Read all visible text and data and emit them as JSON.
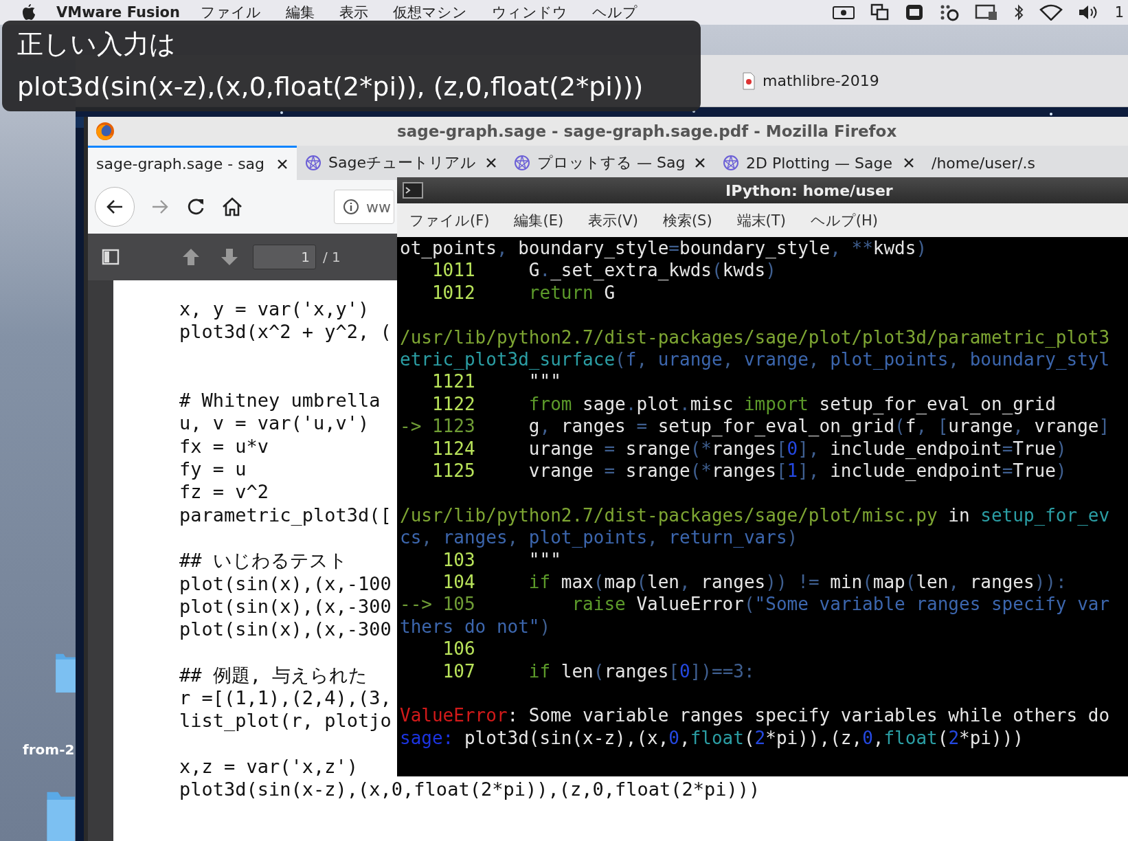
{
  "menu_bar": {
    "app_name": "VMware Fusion",
    "items": [
      "ファイル",
      "編集",
      "表示",
      "仮想マシン",
      "ウィンドウ",
      "ヘルプ"
    ],
    "clock": "1"
  },
  "caption": {
    "lines": [
      "正しい入力は",
      "plot3d(sin(x-z),(x,0,float(2*pi)), (z,0,float(2*pi)))"
    ]
  },
  "vm_window": {
    "tab": "mathlibre-2019"
  },
  "desktop": {
    "icons": [
      {
        "label": "from-2"
      }
    ]
  },
  "browser": {
    "title": "sage-graph.sage - sage-graph.sage.pdf - Mozilla Firefox",
    "tabs": [
      {
        "label": "sage-graph.sage - sag",
        "selected": true,
        "kind": "doc"
      },
      {
        "label": "Sageチュートリアル",
        "selected": false,
        "kind": "sage"
      },
      {
        "label": "プロットする — Sag",
        "selected": false,
        "kind": "sage"
      },
      {
        "label": "2D Plotting — Sage",
        "selected": false,
        "kind": "sage"
      },
      {
        "label": "/home/user/.s",
        "selected": false,
        "kind": "doc"
      }
    ],
    "url": "ww",
    "pdf_toolbar": {
      "page": "1",
      "page_count": "/ 1"
    },
    "pdf_blocks": [
      [
        "x, y = var('x,y')",
        "plot3d(x^2 + y^2, ("
      ],
      [
        "# Whitney umbrella",
        "u, v = var('u,v')",
        "fx = u*v",
        "fy = u",
        "fz = v^2",
        "parametric_plot3d(["
      ],
      [
        "## いじわるテスト",
        "plot(sin(x),(x,-100",
        "plot(sin(x),(x,-300",
        "plot(sin(x),(x,-300"
      ],
      [
        "## 例題, 与えられた",
        "r =[(1,1),(2,4),(3,",
        "list_plot(r, plotjo"
      ],
      [
        "x,z = var('x,z')",
        "plot3d(sin(x-z),(x,0,float(2*pi)),(z,0,float(2*pi)))"
      ]
    ]
  },
  "terminal": {
    "title": "IPython: home/user",
    "menu": [
      "ファイル(F)",
      "編集(E)",
      "表示(V)",
      "検索(S)",
      "端末(T)",
      "ヘルプ(H)"
    ],
    "blocks": [
      [
        [
          {
            "kind": "plain",
            "text": "ot_points"
          },
          {
            "kind": "punct",
            "text": ", "
          },
          {
            "kind": "plain",
            "text": "boundary_style"
          },
          {
            "kind": "punct",
            "text": "="
          },
          {
            "kind": "plain",
            "text": "boundary_style"
          },
          {
            "kind": "punct",
            "text": ", **"
          },
          {
            "kind": "plain",
            "text": "kwds"
          },
          {
            "kind": "punct",
            "text": ")"
          }
        ],
        [
          {
            "kind": "lineno",
            "text": "   1011"
          },
          {
            "kind": "plain",
            "text": "     G"
          },
          {
            "kind": "punct",
            "text": "."
          },
          {
            "kind": "plain",
            "text": "_set_extra_kwds"
          },
          {
            "kind": "punct",
            "text": "("
          },
          {
            "kind": "plain",
            "text": "kwds"
          },
          {
            "kind": "punct",
            "text": ")"
          }
        ],
        [
          {
            "kind": "lineno",
            "text": "   1012"
          },
          {
            "kind": "kw",
            "text": "     return"
          },
          {
            "kind": "plain",
            "text": " G"
          }
        ]
      ],
      [
        [
          {
            "kind": "path",
            "text": "/usr/lib/python2.7/dist-packages/sage/plot/plot3d/parametric_plot3"
          }
        ],
        [
          {
            "kind": "func",
            "text": "etric_plot3d_surface"
          },
          {
            "kind": "punct",
            "text": "("
          },
          {
            "kind": "arg",
            "text": "f"
          },
          {
            "kind": "punct",
            "text": ", "
          },
          {
            "kind": "arg",
            "text": "urange"
          },
          {
            "kind": "punct",
            "text": ", "
          },
          {
            "kind": "arg",
            "text": "vrange"
          },
          {
            "kind": "punct",
            "text": ", "
          },
          {
            "kind": "arg",
            "text": "plot_points"
          },
          {
            "kind": "punct",
            "text": ", "
          },
          {
            "kind": "arg",
            "text": "boundary_styl"
          }
        ],
        [
          {
            "kind": "lineno",
            "text": "   1121"
          },
          {
            "kind": "plain",
            "text": "     \"\"\""
          }
        ],
        [
          {
            "kind": "lineno",
            "text": "   1122"
          },
          {
            "kind": "kw",
            "text": "     from"
          },
          {
            "kind": "plain",
            "text": " sage"
          },
          {
            "kind": "punct",
            "text": "."
          },
          {
            "kind": "plain",
            "text": "plot"
          },
          {
            "kind": "punct",
            "text": "."
          },
          {
            "kind": "plain",
            "text": "misc "
          },
          {
            "kind": "kw",
            "text": "import"
          },
          {
            "kind": "plain",
            "text": " setup_for_eval_on_grid"
          }
        ],
        [
          {
            "kind": "arrow",
            "text": "-> 1123"
          },
          {
            "kind": "plain",
            "text": "     g"
          },
          {
            "kind": "punct",
            "text": ", "
          },
          {
            "kind": "plain",
            "text": "ranges "
          },
          {
            "kind": "punct",
            "text": "= "
          },
          {
            "kind": "plain",
            "text": "setup_for_eval_on_grid"
          },
          {
            "kind": "punct",
            "text": "("
          },
          {
            "kind": "plain",
            "text": "f"
          },
          {
            "kind": "punct",
            "text": ", ["
          },
          {
            "kind": "plain",
            "text": "urange"
          },
          {
            "kind": "punct",
            "text": ", "
          },
          {
            "kind": "plain",
            "text": "vrange"
          },
          {
            "kind": "punct",
            "text": "]"
          }
        ],
        [
          {
            "kind": "lineno",
            "text": "   1124"
          },
          {
            "kind": "plain",
            "text": "     urange "
          },
          {
            "kind": "punct",
            "text": "= "
          },
          {
            "kind": "plain",
            "text": "srange"
          },
          {
            "kind": "punct",
            "text": "(*"
          },
          {
            "kind": "plain",
            "text": "ranges"
          },
          {
            "kind": "punct",
            "text": "["
          },
          {
            "kind": "num",
            "text": "0"
          },
          {
            "kind": "punct",
            "text": "], "
          },
          {
            "kind": "plain",
            "text": "include_endpoint"
          },
          {
            "kind": "punct",
            "text": "="
          },
          {
            "kind": "plain",
            "text": "True"
          },
          {
            "kind": "punct",
            "text": ")"
          }
        ],
        [
          {
            "kind": "lineno",
            "text": "   1125"
          },
          {
            "kind": "plain",
            "text": "     vrange "
          },
          {
            "kind": "punct",
            "text": "= "
          },
          {
            "kind": "plain",
            "text": "srange"
          },
          {
            "kind": "punct",
            "text": "(*"
          },
          {
            "kind": "plain",
            "text": "ranges"
          },
          {
            "kind": "punct",
            "text": "["
          },
          {
            "kind": "num",
            "text": "1"
          },
          {
            "kind": "punct",
            "text": "], "
          },
          {
            "kind": "plain",
            "text": "include_endpoint"
          },
          {
            "kind": "punct",
            "text": "="
          },
          {
            "kind": "plain",
            "text": "True"
          },
          {
            "kind": "punct",
            "text": ")"
          }
        ]
      ],
      [
        [
          {
            "kind": "path",
            "text": "/usr/lib/python2.7/dist-packages/sage/plot/misc.py"
          },
          {
            "kind": "plain",
            "text": " in "
          },
          {
            "kind": "func",
            "text": "setup_for_ev"
          }
        ],
        [
          {
            "kind": "arg",
            "text": "cs"
          },
          {
            "kind": "punct",
            "text": ", "
          },
          {
            "kind": "arg",
            "text": "ranges"
          },
          {
            "kind": "punct",
            "text": ", "
          },
          {
            "kind": "arg",
            "text": "plot_points"
          },
          {
            "kind": "punct",
            "text": ", "
          },
          {
            "kind": "arg",
            "text": "return_vars"
          },
          {
            "kind": "punct",
            "text": ")"
          }
        ],
        [
          {
            "kind": "lineno",
            "text": "    103"
          },
          {
            "kind": "plain",
            "text": "     \"\"\""
          }
        ],
        [
          {
            "kind": "lineno",
            "text": "    104"
          },
          {
            "kind": "kw",
            "text": "     if"
          },
          {
            "kind": "plain",
            "text": " max"
          },
          {
            "kind": "punct",
            "text": "("
          },
          {
            "kind": "plain",
            "text": "map"
          },
          {
            "kind": "punct",
            "text": "("
          },
          {
            "kind": "plain",
            "text": "len"
          },
          {
            "kind": "punct",
            "text": ", "
          },
          {
            "kind": "plain",
            "text": "ranges"
          },
          {
            "kind": "punct",
            "text": ")) != "
          },
          {
            "kind": "plain",
            "text": "min"
          },
          {
            "kind": "punct",
            "text": "("
          },
          {
            "kind": "plain",
            "text": "map"
          },
          {
            "kind": "punct",
            "text": "("
          },
          {
            "kind": "plain",
            "text": "len"
          },
          {
            "kind": "punct",
            "text": ", "
          },
          {
            "kind": "plain",
            "text": "ranges"
          },
          {
            "kind": "punct",
            "text": ")):"
          }
        ],
        [
          {
            "kind": "arrow",
            "text": "--> 105"
          },
          {
            "kind": "kw",
            "text": "         raise"
          },
          {
            "kind": "plain",
            "text": " ValueError"
          },
          {
            "kind": "punct",
            "text": "("
          },
          {
            "kind": "str",
            "text": "\"Some variable ranges specify var"
          }
        ],
        [
          {
            "kind": "str",
            "text": "thers do not\""
          },
          {
            "kind": "punct",
            "text": ")"
          }
        ],
        [
          {
            "kind": "lineno",
            "text": "    106"
          }
        ],
        [
          {
            "kind": "lineno",
            "text": "    107"
          },
          {
            "kind": "kw",
            "text": "     if"
          },
          {
            "kind": "plain",
            "text": " len"
          },
          {
            "kind": "punct",
            "text": "("
          },
          {
            "kind": "plain",
            "text": "ranges"
          },
          {
            "kind": "punct",
            "text": "["
          },
          {
            "kind": "num",
            "text": "0"
          },
          {
            "kind": "punct",
            "text": "])==3:"
          }
        ]
      ],
      [
        [
          {
            "kind": "err",
            "text": "ValueError"
          },
          {
            "kind": "plain",
            "text": ": Some variable ranges specify variables while others do"
          }
        ],
        [
          {
            "kind": "prompt",
            "text": "sage: "
          },
          {
            "kind": "plain",
            "text": "plot3d(sin(x-z),(x,"
          },
          {
            "kind": "num",
            "text": "0"
          },
          {
            "kind": "plain",
            "text": ","
          },
          {
            "kind": "func",
            "text": "float"
          },
          {
            "kind": "plain",
            "text": "("
          },
          {
            "kind": "num",
            "text": "2"
          },
          {
            "kind": "plain",
            "text": "*pi)),(z,"
          },
          {
            "kind": "num",
            "text": "0"
          },
          {
            "kind": "plain",
            "text": ","
          },
          {
            "kind": "func",
            "text": "float"
          },
          {
            "kind": "plain",
            "text": "("
          },
          {
            "kind": "num",
            "text": "2"
          },
          {
            "kind": "plain",
            "text": "*pi)))"
          }
        ]
      ]
    ]
  }
}
